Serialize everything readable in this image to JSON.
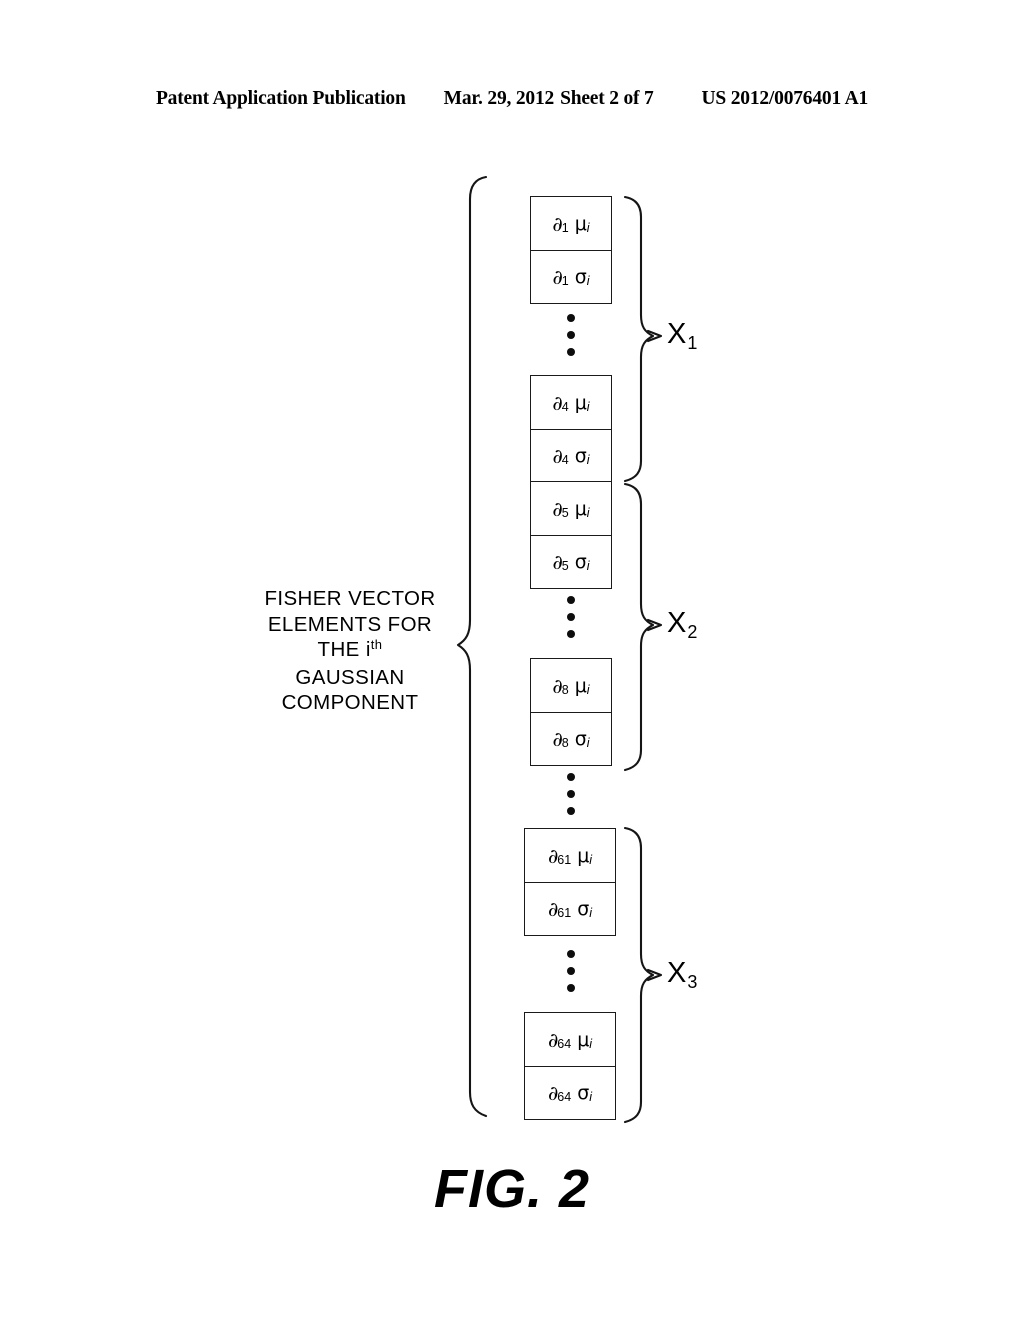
{
  "header": {
    "publication": "Patent Application Publication",
    "date": "Mar. 29, 2012",
    "sheet": "Sheet 2 of 7",
    "patent_number": "US 2012/0076401 A1"
  },
  "figure": {
    "number": "FIG. 2",
    "caption_line1": "FISHER VECTOR",
    "caption_line2": "ELEMENTS FOR",
    "caption_line3_pre": "THE i",
    "caption_line3_sup": "th",
    "caption_line4": "GAUSSIAN",
    "caption_line5": "COMPONENT",
    "partial_symbol": "∂",
    "mu_symbol": "μ",
    "sigma_symbol": "σ",
    "component_subscript": "i",
    "boxes": [
      {
        "index": "1",
        "kind": "mu"
      },
      {
        "index": "1",
        "kind": "sigma"
      },
      {
        "index": "4",
        "kind": "mu"
      },
      {
        "index": "4",
        "kind": "sigma"
      },
      {
        "index": "5",
        "kind": "mu"
      },
      {
        "index": "5",
        "kind": "sigma"
      },
      {
        "index": "8",
        "kind": "mu"
      },
      {
        "index": "8",
        "kind": "sigma"
      },
      {
        "index": "61",
        "kind": "mu"
      },
      {
        "index": "61",
        "kind": "sigma"
      },
      {
        "index": "64",
        "kind": "mu"
      },
      {
        "index": "64",
        "kind": "sigma"
      }
    ],
    "groups": [
      {
        "label": "X",
        "subscript": "1",
        "first_box": "∂1 μi",
        "last_box": "∂4 σi"
      },
      {
        "label": "X",
        "subscript": "2",
        "first_box": "∂5 μi",
        "last_box": "∂8 σi"
      },
      {
        "label": "X",
        "subscript": "3",
        "first_box": "∂61 μi",
        "last_box": "∂64 σi"
      }
    ],
    "colors": {
      "ink": "#000000",
      "paper": "#ffffff",
      "rule": "#1a1a1a"
    }
  }
}
